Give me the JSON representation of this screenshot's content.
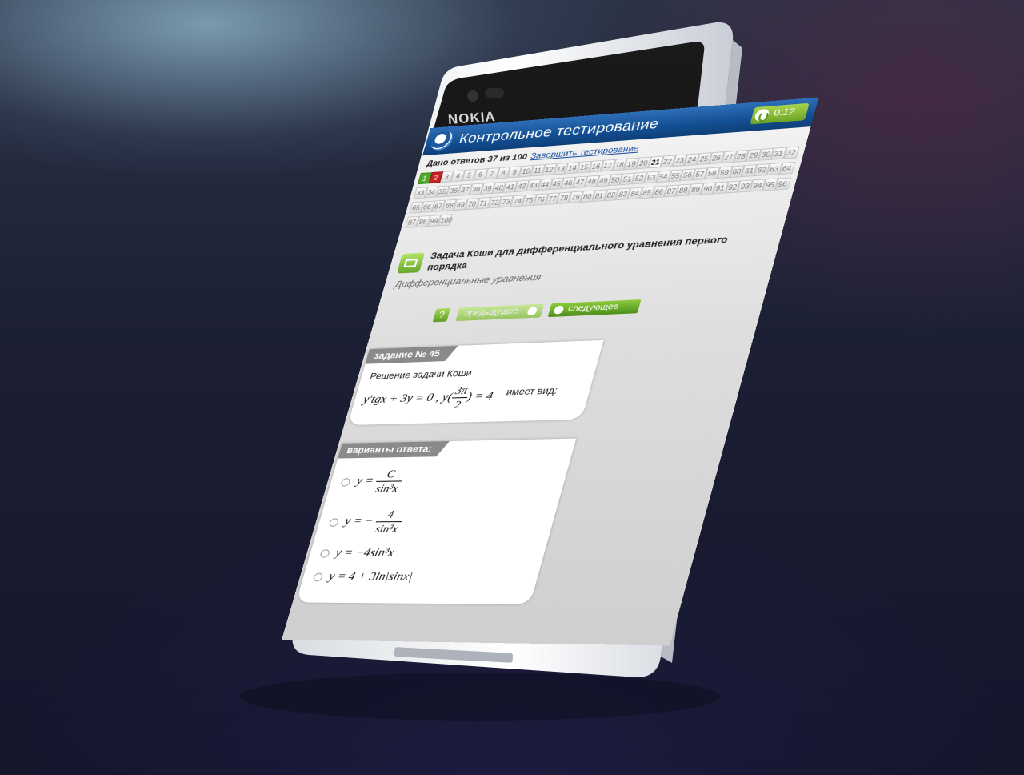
{
  "device": {
    "brand": "NOKIA"
  },
  "app": {
    "title": "Контрольное тестирование",
    "timer": "0:12",
    "answered_label": "Дано ответов 37 из 100",
    "finish_link": "Завершить тестирование"
  },
  "questions_grid": {
    "numbers": [
      "1",
      "2",
      "3",
      "4",
      "5",
      "6",
      "7",
      "8",
      "9",
      "10",
      "11",
      "12",
      "13",
      "14",
      "15",
      "16",
      "17",
      "18",
      "19",
      "20",
      "21",
      "22",
      "23",
      "24",
      "25",
      "26",
      "27",
      "28",
      "29",
      "30",
      "31",
      "32",
      "33",
      "34",
      "35",
      "36",
      "37",
      "38",
      "39",
      "40",
      "41",
      "42",
      "43",
      "44",
      "45",
      "46",
      "47",
      "48",
      "49",
      "50",
      "51",
      "52",
      "53",
      "54",
      "55",
      "56",
      "57",
      "58",
      "59",
      "60",
      "61",
      "62",
      "63",
      "64",
      "65",
      "66",
      "67",
      "68",
      "69",
      "70",
      "71",
      "72",
      "73",
      "74",
      "75",
      "76",
      "77",
      "78",
      "79",
      "80",
      "81",
      "82",
      "83",
      "84",
      "85",
      "86",
      "87",
      "88",
      "89",
      "90",
      "91",
      "92",
      "93",
      "94",
      "95",
      "96",
      "97",
      "98",
      "99",
      "100"
    ],
    "correct": [
      "1"
    ],
    "wrong": [
      "2"
    ],
    "current": "21"
  },
  "topic": {
    "title": "Задача Коши для дифференциального уравнения первого порядка",
    "subject": "Дифференциальные уравнения"
  },
  "nav": {
    "help": "?",
    "prev": "предыдущее",
    "next": "следующее"
  },
  "question": {
    "header": "задание № 45",
    "lead": "Решение задачи Коши",
    "formula_left": "y′tgx + 3y = 0 ,  y",
    "formula_frac_num": "3π",
    "formula_frac_den": "2",
    "formula_right": "= 4",
    "tail": "имеет вид:"
  },
  "answers": {
    "header": "варианты ответа:",
    "options": [
      {
        "prefix": "y =",
        "num": "C",
        "den": "sin³x"
      },
      {
        "prefix": "y = −",
        "num": "4",
        "den": "sin³x"
      },
      {
        "text": "y = −4sin³x"
      },
      {
        "text": "y = 4 + 3ln|sinx|"
      }
    ]
  },
  "softkeys": {
    "back": "←",
    "start": "⊞",
    "search": "⌕"
  },
  "colors": {
    "header_blue": "#134f93",
    "accent_green": "#6ea326",
    "wrong_red": "#c62225"
  }
}
